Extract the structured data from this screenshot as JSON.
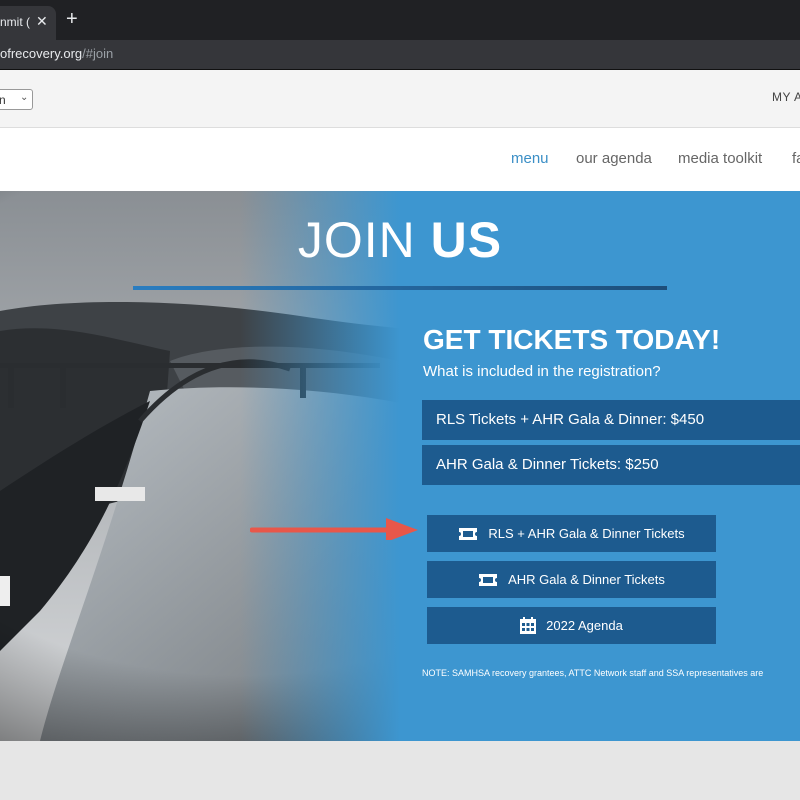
{
  "browser": {
    "tab_title": "nmit (",
    "tab_close": "✕",
    "new_tab": "+",
    "url_host": "ofrecovery.org",
    "url_path": "/#join"
  },
  "utility": {
    "language_value": "n",
    "my_account": "MY A"
  },
  "nav": {
    "items": [
      {
        "label": "menu",
        "active": true
      },
      {
        "label": "our agenda"
      },
      {
        "label": "media toolkit"
      },
      {
        "label": "fa"
      }
    ]
  },
  "hero": {
    "title_light": "JOIN",
    "title_bold": "US",
    "heading": "GET TICKETS TODAY!",
    "subheading": "What is included in the registration?",
    "prices": [
      "RLS Tickets + AHR Gala & Dinner: $450",
      "AHR Gala & Dinner Tickets: $250"
    ],
    "buttons": [
      {
        "label": "RLS + AHR Gala & Dinner Tickets",
        "icon": "ticket-icon"
      },
      {
        "label": "AHR Gala & Dinner Tickets",
        "icon": "ticket-icon"
      },
      {
        "label": "2022 Agenda",
        "icon": "calendar-icon"
      }
    ],
    "note": "NOTE: SAMHSA recovery grantees, ATTC Network staff and SSA representatives are"
  },
  "colors": {
    "hero_blue": "#3d96d0",
    "button_navy": "#1d5b8f",
    "accent_link": "#3b8fc6",
    "arrow_red": "#e8574a"
  }
}
